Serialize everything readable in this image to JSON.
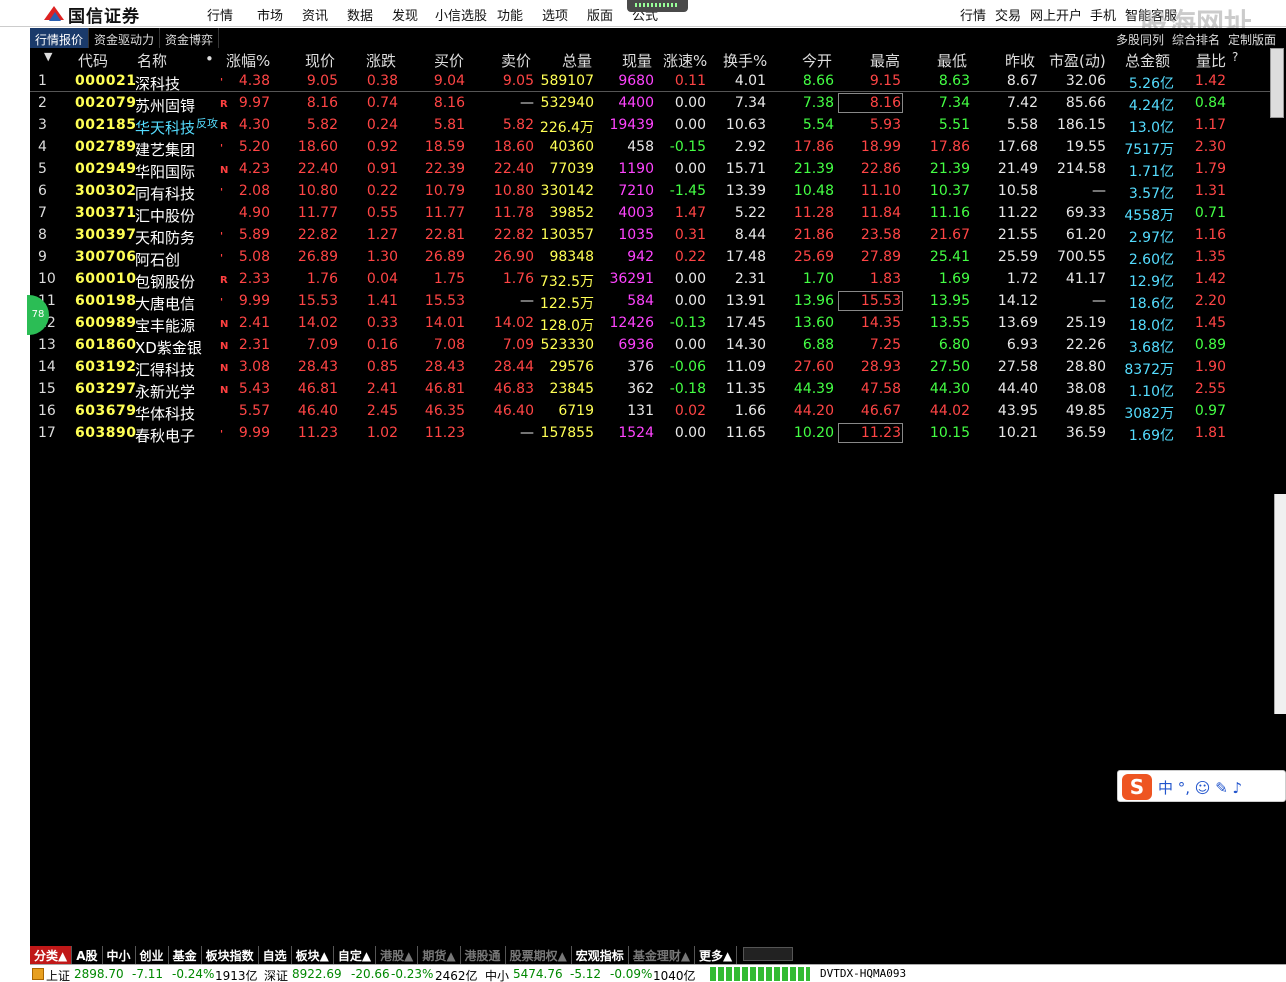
{
  "app": {
    "logo_text": "国信证券",
    "menu": [
      "行情",
      "市场",
      "资讯",
      "数据",
      "发现",
      "小信选股",
      "功能",
      "选项",
      "版面",
      "公式"
    ],
    "right_menu": [
      "行情",
      "交易",
      "网上开户",
      "手机",
      "智能客服"
    ],
    "watermark": "股海网址"
  },
  "tabs": {
    "left": [
      "行情报价",
      "资金驱动力",
      "资金博弈"
    ],
    "right": [
      "多股同列",
      "综合排名",
      "定制版面"
    ]
  },
  "table": {
    "headers": [
      "代码",
      "名称",
      "•",
      "涨幅%",
      "现价",
      "涨跌",
      "买价",
      "卖价",
      "总量",
      "现量",
      "涨速%",
      "换手%",
      "今开",
      "最高",
      "最低",
      "昨收",
      "市盈(动)",
      "总金额",
      "量比",
      "?"
    ],
    "rows": [
      {
        "idx": "1",
        "code": "000021",
        "name": "深科技",
        "flag": "'",
        "pct": "4.38",
        "price": "9.05",
        "chg": "0.38",
        "bid": "9.04",
        "ask": "9.05",
        "vol": "589107",
        "cur": "9680",
        "spd": "0.11",
        "turn": "4.01",
        "open": "8.66",
        "high": "9.15",
        "low": "8.63",
        "prev": "8.67",
        "pe": "32.06",
        "amt": "5.26亿",
        "ratio": "1.42"
      },
      {
        "idx": "2",
        "code": "002079",
        "name": "苏州固锝",
        "flag": "R",
        "pct": "9.97",
        "price": "8.16",
        "chg": "0.74",
        "bid": "8.16",
        "ask": "—",
        "vol": "532940",
        "cur": "4400",
        "spd": "0.00",
        "turn": "7.34",
        "open": "7.38",
        "high": "8.16",
        "low": "7.34",
        "prev": "7.42",
        "pe": "85.66",
        "amt": "4.24亿",
        "ratio": "0.84"
      },
      {
        "idx": "3",
        "code": "002185",
        "name": "华天科技",
        "tag": "反攻",
        "flag": "R",
        "pct": "4.30",
        "price": "5.82",
        "chg": "0.24",
        "bid": "5.81",
        "ask": "5.82",
        "vol": "226.4万",
        "cur": "19439",
        "spd": "0.00",
        "turn": "10.63",
        "open": "5.54",
        "high": "5.93",
        "low": "5.51",
        "prev": "5.58",
        "pe": "186.15",
        "amt": "13.0亿",
        "ratio": "1.17"
      },
      {
        "idx": "4",
        "code": "002789",
        "name": "建艺集团",
        "flag": "'",
        "pct": "5.20",
        "price": "18.60",
        "chg": "0.92",
        "bid": "18.59",
        "ask": "18.60",
        "vol": "40360",
        "cur": "458",
        "spd": "-0.15",
        "turn": "2.92",
        "open": "17.86",
        "high": "18.99",
        "low": "17.86",
        "prev": "17.68",
        "pe": "19.55",
        "amt": "7517万",
        "ratio": "2.30"
      },
      {
        "idx": "5",
        "code": "002949",
        "name": "华阳国际",
        "flag": "N",
        "pct": "4.23",
        "price": "22.40",
        "chg": "0.91",
        "bid": "22.39",
        "ask": "22.40",
        "vol": "77039",
        "cur": "1190",
        "spd": "0.00",
        "turn": "15.71",
        "open": "21.39",
        "high": "22.86",
        "low": "21.39",
        "prev": "21.49",
        "pe": "214.58",
        "amt": "1.71亿",
        "ratio": "1.79"
      },
      {
        "idx": "6",
        "code": "300302",
        "name": "同有科技",
        "flag": "'",
        "pct": "2.08",
        "price": "10.80",
        "chg": "0.22",
        "bid": "10.79",
        "ask": "10.80",
        "vol": "330142",
        "cur": "7210",
        "spd": "-1.45",
        "turn": "13.39",
        "open": "10.48",
        "high": "11.10",
        "low": "10.37",
        "prev": "10.58",
        "pe": "—",
        "amt": "3.57亿",
        "ratio": "1.31"
      },
      {
        "idx": "7",
        "code": "300371",
        "name": "汇中股份",
        "flag": "",
        "pct": "4.90",
        "price": "11.77",
        "chg": "0.55",
        "bid": "11.77",
        "ask": "11.78",
        "vol": "39852",
        "cur": "4003",
        "spd": "1.47",
        "turn": "5.22",
        "open": "11.28",
        "high": "11.84",
        "low": "11.16",
        "prev": "11.22",
        "pe": "69.33",
        "amt": "4558万",
        "ratio": "0.71"
      },
      {
        "idx": "8",
        "code": "300397",
        "name": "天和防务",
        "flag": "'",
        "pct": "5.89",
        "price": "22.82",
        "chg": "1.27",
        "bid": "22.81",
        "ask": "22.82",
        "vol": "130357",
        "cur": "1035",
        "spd": "0.31",
        "turn": "8.44",
        "open": "21.86",
        "high": "23.58",
        "low": "21.67",
        "prev": "21.55",
        "pe": "61.20",
        "amt": "2.97亿",
        "ratio": "1.16"
      },
      {
        "idx": "9",
        "code": "300706",
        "name": "阿石创",
        "flag": "'",
        "pct": "5.08",
        "price": "26.89",
        "chg": "1.30",
        "bid": "26.89",
        "ask": "26.90",
        "vol": "98348",
        "cur": "942",
        "spd": "0.22",
        "turn": "17.48",
        "open": "25.69",
        "high": "27.89",
        "low": "25.41",
        "prev": "25.59",
        "pe": "700.55",
        "amt": "2.60亿",
        "ratio": "1.35"
      },
      {
        "idx": "10",
        "code": "600010",
        "name": "包钢股份",
        "flag": "R",
        "pct": "2.33",
        "price": "1.76",
        "chg": "0.04",
        "bid": "1.75",
        "ask": "1.76",
        "vol": "732.5万",
        "cur": "36291",
        "spd": "0.00",
        "turn": "2.31",
        "open": "1.70",
        "high": "1.83",
        "low": "1.69",
        "prev": "1.72",
        "pe": "41.17",
        "amt": "12.9亿",
        "ratio": "1.42"
      },
      {
        "idx": "11",
        "code": "600198",
        "name": "大唐电信",
        "flag": "'",
        "pct": "9.99",
        "price": "15.53",
        "chg": "1.41",
        "bid": "15.53",
        "ask": "—",
        "vol": "122.5万",
        "cur": "584",
        "spd": "0.00",
        "turn": "13.91",
        "open": "13.96",
        "high": "15.53",
        "low": "13.95",
        "prev": "14.12",
        "pe": "—",
        "amt": "18.6亿",
        "ratio": "2.20"
      },
      {
        "idx": "12",
        "code": "600989",
        "name": "宝丰能源",
        "flag": "N",
        "pct": "2.41",
        "price": "14.02",
        "chg": "0.33",
        "bid": "14.01",
        "ask": "14.02",
        "vol": "128.0万",
        "cur": "12426",
        "spd": "-0.13",
        "turn": "17.45",
        "open": "13.60",
        "high": "14.35",
        "low": "13.55",
        "prev": "13.69",
        "pe": "25.19",
        "amt": "18.0亿",
        "ratio": "1.45"
      },
      {
        "idx": "13",
        "code": "601860",
        "name": "XD紫金银",
        "flag": "N",
        "pct": "2.31",
        "price": "7.09",
        "chg": "0.16",
        "bid": "7.08",
        "ask": "7.09",
        "vol": "523330",
        "cur": "6936",
        "spd": "0.00",
        "turn": "14.30",
        "open": "6.88",
        "high": "7.25",
        "low": "6.80",
        "prev": "6.93",
        "pe": "22.26",
        "amt": "3.68亿",
        "ratio": "0.89"
      },
      {
        "idx": "14",
        "code": "603192",
        "name": "汇得科技",
        "flag": "N",
        "pct": "3.08",
        "price": "28.43",
        "chg": "0.85",
        "bid": "28.43",
        "ask": "28.44",
        "vol": "29576",
        "cur": "376",
        "spd": "-0.06",
        "turn": "11.09",
        "open": "27.60",
        "high": "28.93",
        "low": "27.50",
        "prev": "27.58",
        "pe": "28.80",
        "amt": "8372万",
        "ratio": "1.90"
      },
      {
        "idx": "15",
        "code": "603297",
        "name": "永新光学",
        "flag": "N",
        "pct": "5.43",
        "price": "46.81",
        "chg": "2.41",
        "bid": "46.81",
        "ask": "46.83",
        "vol": "23845",
        "cur": "362",
        "spd": "-0.18",
        "turn": "11.35",
        "open": "44.39",
        "high": "47.58",
        "low": "44.30",
        "prev": "44.40",
        "pe": "38.08",
        "amt": "1.10亿",
        "ratio": "2.55"
      },
      {
        "idx": "16",
        "code": "603679",
        "name": "华体科技",
        "flag": "",
        "pct": "5.57",
        "price": "46.40",
        "chg": "2.45",
        "bid": "46.35",
        "ask": "46.40",
        "vol": "6719",
        "cur": "131",
        "spd": "0.02",
        "turn": "1.66",
        "open": "44.20",
        "high": "46.67",
        "low": "44.02",
        "prev": "43.95",
        "pe": "49.85",
        "amt": "3082万",
        "ratio": "0.97"
      },
      {
        "idx": "17",
        "code": "603890",
        "name": "春秋电子",
        "flag": "'",
        "pct": "9.99",
        "price": "11.23",
        "chg": "1.02",
        "bid": "11.23",
        "ask": "—",
        "vol": "157855",
        "cur": "1524",
        "spd": "0.00",
        "turn": "11.65",
        "open": "10.20",
        "high": "11.23",
        "low": "10.15",
        "prev": "10.21",
        "pe": "36.59",
        "amt": "1.69亿",
        "ratio": "1.81"
      }
    ]
  },
  "bubble": "78",
  "ime": {
    "logo": "S",
    "tools": "中 °, ☺ ✎ ♪"
  },
  "sheets": [
    "分类▲",
    "A股",
    "中小",
    "创业",
    "基金",
    "板块指数",
    "自选",
    "板块▲",
    "自定▲",
    "港股▲",
    "期货▲",
    "港股通",
    "股票期权▲",
    "宏观指标",
    "基金理财▲",
    "更多▲"
  ],
  "status": {
    "sh_label": "上证",
    "sh_val": "2898.70",
    "sh_chg": "-7.11",
    "sh_pct": "-0.24%",
    "sh_amt": "1913亿",
    "sz_label": "深证",
    "sz_val": "8922.69",
    "sz_chg": "-20.66",
    "sz_pct": "-0.23%",
    "sz_amt": "2462亿",
    "zx_label": "中小",
    "zx_val": "5474.76",
    "zx_chg": "-5.12",
    "zx_pct": "-0.09%",
    "zx_amt": "1040亿",
    "server": "DVTDX-HQMA093"
  },
  "colors": {
    "bg": "#000000",
    "up": "#ff4545",
    "down": "#44ff44",
    "code": "#ffff55",
    "volume": "#ff44ff",
    "amount": "#55ddff"
  }
}
